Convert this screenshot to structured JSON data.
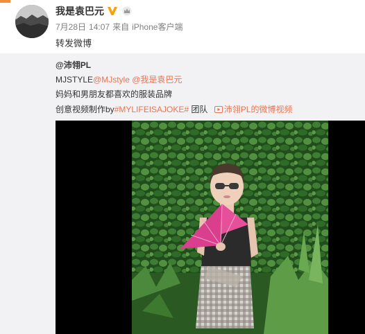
{
  "post": {
    "username": "我是袁巴元",
    "verified_icon": "verified-v-icon",
    "crown_icon": "crown-icon",
    "date": "7月28日",
    "time": "14:07",
    "source_prefix": "来自",
    "source": "iPhone客户端",
    "text": "转发微博"
  },
  "repost": {
    "author": "@沛翎PL",
    "line1_prefix": "MJSTYLE",
    "line1_mention1": "@MJstyle",
    "line1_mention2": "@我是袁巴元",
    "line2": "妈妈和男朋友都喜欢的服装品牌",
    "line3_prefix": "创意视频制作by",
    "line3_hashtag": "#MYLIFEISAJOKE#",
    "line3_team": "团队",
    "video_link": "沛翎PL的微博视频"
  },
  "colors": {
    "link": "#eb7350",
    "meta": "#808080",
    "repost_bg": "#f2f2f5",
    "verified": "#f8a20a"
  }
}
